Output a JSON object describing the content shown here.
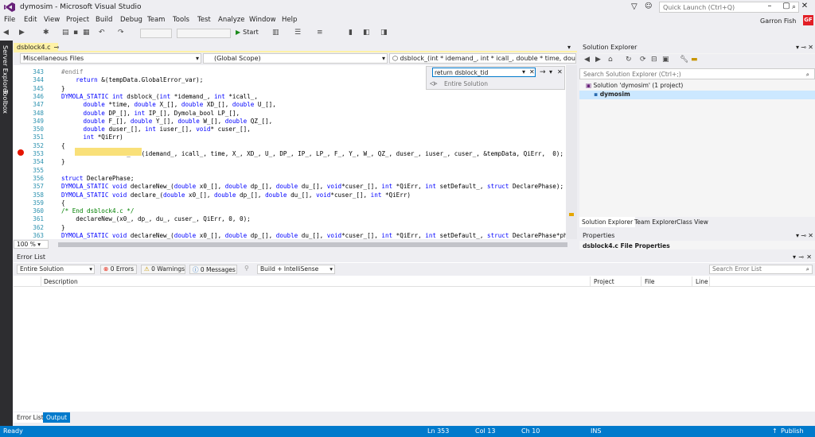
{
  "window": {
    "title": "dymosim - Microsoft Visual Studio",
    "quick_launch_placeholder": "Quick Launch (Ctrl+Q)",
    "user_name": "Garron Fish",
    "user_initials": "GF"
  },
  "menu": [
    "File",
    "Edit",
    "View",
    "Project",
    "Build",
    "Debug",
    "Team",
    "Tools",
    "Test",
    "Analyze",
    "Window",
    "Help"
  ],
  "toolbar": {
    "start_label": "Start"
  },
  "left_rail": {
    "server_explorer": "Server Explorer",
    "toolbox": "Toolbox"
  },
  "editor": {
    "tab_label": "dsblock4.c",
    "file_scope": "Miscellaneous Files",
    "global_scope": "(Global Scope)",
    "member_scope": "dsblock_(int * idemand_, int * icall_, double * time, double X_[]",
    "zoom": "100 %",
    "find": {
      "value": "return dsblock_tid",
      "scope": "Entire Solution"
    },
    "lines": [
      {
        "n": "343",
        "t": "#endif"
      },
      {
        "n": "344",
        "t": "    return &(tempData.GlobalError_var);"
      },
      {
        "n": "345",
        "t": "}"
      },
      {
        "n": "346",
        "t": "DYMOLA_STATIC int dsblock_(int *idemand_, int *icall_,"
      },
      {
        "n": "347",
        "t": "      double *time, double X_[], double XD_[], double U_[],"
      },
      {
        "n": "348",
        "t": "      double DP_[], int IP_[], Dymola_bool LP_[],"
      },
      {
        "n": "349",
        "t": "      double F_[], double Y_[], double W_[], double QZ_[],"
      },
      {
        "n": "350",
        "t": "      double duser_[], int iuser_[], void* cuser_[],"
      },
      {
        "n": "351",
        "t": "      int *QiErr)"
      },
      {
        "n": "352",
        "t": "{"
      },
      {
        "n": "353",
        "t": "    return dsblock_tid(idemand_, icall_, time, X_, XD_, U_, DP_, IP_, LP_, F_, Y_, W_, QZ_, duser_, iuser_, cuser_, &tempData, QiErr,  0);"
      },
      {
        "n": "354",
        "t": "}"
      },
      {
        "n": "355",
        "t": ""
      },
      {
        "n": "356",
        "t": "struct DeclarePhase;"
      },
      {
        "n": "357",
        "t": "DYMOLA_STATIC void declareNew_(double x0_[], double dp_[], double du_[], void*cuser_[], int *QiErr, int setDefault_, struct DeclarePhase);"
      },
      {
        "n": "358",
        "t": "DYMOLA_STATIC void declare_(double x0_[], double dp_[], double du_[], void*cuser_[], int *QiErr)"
      },
      {
        "n": "359",
        "t": "{"
      },
      {
        "n": "360",
        "t": "/* End dsblock4.c */"
      },
      {
        "n": "361",
        "t": "    declareNew_(x0_, dp_, du_, cuser_, QiErr, 0, 0);"
      },
      {
        "n": "362",
        "t": "}"
      },
      {
        "n": "363",
        "t": "DYMOLA_STATIC void declareNew_(double x0_[], double dp_[], double du_[], void*cuser_[], int *QiErr, int setDefault_, struct DeclarePhase*phase"
      }
    ]
  },
  "solution_explorer": {
    "title": "Solution Explorer",
    "search_placeholder": "Search Solution Explorer (Ctrl+;)",
    "solution_label": "Solution 'dymosim' (1 project)",
    "project_label": "dymosim",
    "tabs": [
      "Solution Explorer",
      "Team Explorer",
      "Class View"
    ]
  },
  "properties": {
    "title": "Properties",
    "object_label": "dsblock4.c  File Properties"
  },
  "error_list": {
    "title": "Error List",
    "scope": "Entire Solution",
    "errors": "0 Errors",
    "warnings": "0 Warnings",
    "messages": "0 Messages",
    "build_filter": "Build + IntelliSense",
    "search_placeholder": "Search Error List",
    "columns": [
      "Description",
      "Project",
      "File",
      "Line"
    ]
  },
  "bottom_tabs": [
    "Error List",
    "Output"
  ],
  "status": {
    "state": "Ready",
    "ln": "Ln 353",
    "col": "Col 13",
    "ch": "Ch 10",
    "mode": "INS",
    "publish": "Publish"
  }
}
